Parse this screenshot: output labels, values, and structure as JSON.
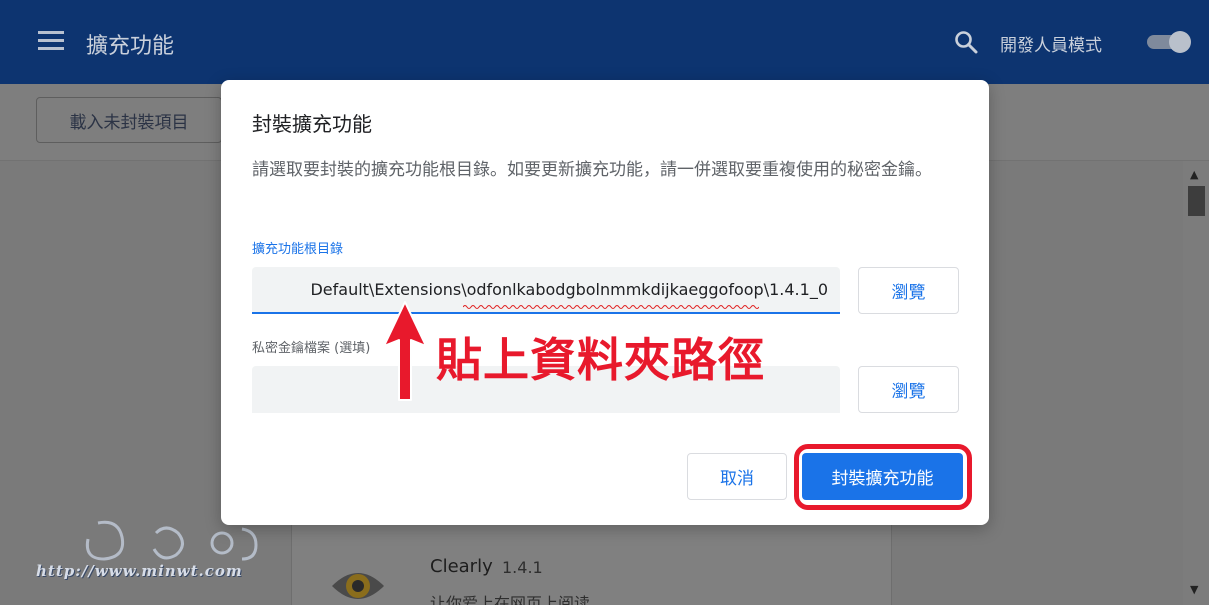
{
  "header": {
    "app_title": "擴充功能",
    "developer_mode_label": "開發人員模式",
    "developer_mode_on": true
  },
  "toolbar": {
    "load_unpacked_label": "載入未封裝項目"
  },
  "extension_card": {
    "name": "Clearly",
    "version": "1.4.1",
    "description": "让你爱上在网页上阅读"
  },
  "watermark": {
    "url_text": "http://www.minwt.com"
  },
  "dialog": {
    "title": "封裝擴充功能",
    "description": "請選取要封裝的擴充功能根目錄。如要更新擴充功能，請一併選取要重複使用的秘密金鑰。",
    "root_dir_label": "擴充功能根目錄",
    "root_dir_value": "Default\\Extensions\\odfonlkabodgbolnmmkdijkaeggofoop\\1.4.1_0",
    "browse_label": "瀏覽",
    "private_key_label": "私密金鑰檔案 (選填)",
    "private_key_value": "",
    "browse2_label": "瀏覽",
    "cancel_label": "取消",
    "pack_label": "封裝擴充功能"
  },
  "annotation": {
    "text": "貼上資料夾路徑"
  },
  "colors": {
    "header_bg": "#0d3470",
    "accent": "#1a73e8",
    "annotation_red": "#e8192c"
  }
}
